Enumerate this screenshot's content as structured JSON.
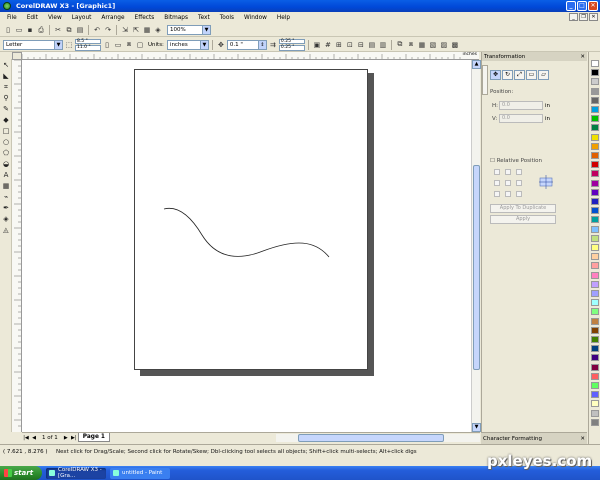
{
  "window": {
    "title": "CorelDRAW X3 - [Graphic1]"
  },
  "menu": [
    "File",
    "Edit",
    "View",
    "Layout",
    "Arrange",
    "Effects",
    "Bitmaps",
    "Text",
    "Tools",
    "Window",
    "Help"
  ],
  "toolbar1": {
    "zoom": "100%"
  },
  "toolbar2": {
    "paper": "Letter",
    "width": "8.5 \"",
    "height": "11.0 \"",
    "units_label": "Units:",
    "units": "inches",
    "nudge": "0.1 \"",
    "dup_x": "0.25 \"",
    "dup_y": "0.25 \""
  },
  "ruler": {
    "label": "inches"
  },
  "docker": {
    "title": "Transformation",
    "position_label": "Position:",
    "h_label": "H:",
    "v_label": "V:",
    "h_value": "0.0",
    "v_value": "0.0",
    "unit": "in",
    "relative_position": "Relative Position",
    "apply_to_duplicate": "Apply To Duplicate",
    "apply": "Apply"
  },
  "page_nav": {
    "count": "1 of 1",
    "tab": "Page 1"
  },
  "character_formatting": {
    "title": "Character Formatting"
  },
  "status": {
    "coords": "( 7.621 , 8.276 )",
    "hint": "Next click for Drag/Scale; Second click for Rotate/Skew; Dbl-clicking tool selects all objects; Shift+click multi-selects; Alt+click digs"
  },
  "taskbar": {
    "start": "start",
    "tasks": [
      "CorelDRAW X3 - [Gra...",
      "untitled - Paint"
    ]
  },
  "watermark": "pxleyes.com",
  "palette": [
    "#ffffff",
    "#000000",
    "#cccccc",
    "#999999",
    "#666666",
    "#00a0e0",
    "#00c000",
    "#008040",
    "#f0e000",
    "#f0a000",
    "#e06000",
    "#d00000",
    "#c00060",
    "#a000a0",
    "#6000c0",
    "#2020c0",
    "#0050d0",
    "#00a0a0",
    "#80c0ff",
    "#c0e080",
    "#ffff80",
    "#ffd0a0",
    "#ffa0a0",
    "#ff80c0",
    "#c0a0ff",
    "#a0a0ff",
    "#a0ffff",
    "#80ff80",
    "#c08040",
    "#804000",
    "#408000",
    "#004080",
    "#400080",
    "#800040",
    "#ff6060",
    "#60ff60",
    "#6060ff",
    "#ffffc0",
    "#c0c0c0",
    "#808080"
  ]
}
